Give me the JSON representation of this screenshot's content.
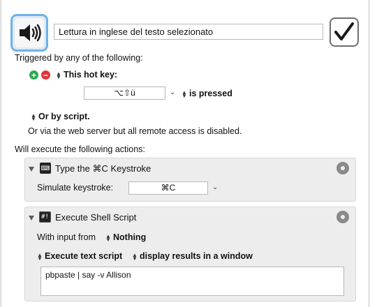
{
  "macro": {
    "name": "Lettura in inglese del testo selezionato",
    "icon": "speaker-icon",
    "enabled_icon": "checkmark-icon"
  },
  "triggers": {
    "heading": "Triggered by any of the following:",
    "hotkey_trigger_label": "This hot key:",
    "hotkey_value": "⌥⇧ù",
    "hotkey_condition": "is pressed",
    "script_trigger_label": "Or by script.",
    "web_server_note": "Or via the web server but all remote access is disabled."
  },
  "actions": {
    "heading": "Will execute the following actions:",
    "items": [
      {
        "title": "Type the ⌘C Keystroke",
        "icon": "keystroke-icon",
        "icon_glyph": "⌨",
        "field_label": "Simulate keystroke:",
        "field_value": "⌘C"
      },
      {
        "title": "Execute Shell Script",
        "icon": "shell-script-icon",
        "icon_glyph": "#!",
        "input_label": "With input from",
        "input_value": "Nothing",
        "mode_value": "Execute text script",
        "output_value": "display results in a window",
        "script": "pbpaste | say -v Allison"
      }
    ]
  },
  "colors": {
    "add_green": "#2fa84f",
    "remove_red": "#e0363b",
    "icon_highlight_blue": "#6fb2e8"
  }
}
